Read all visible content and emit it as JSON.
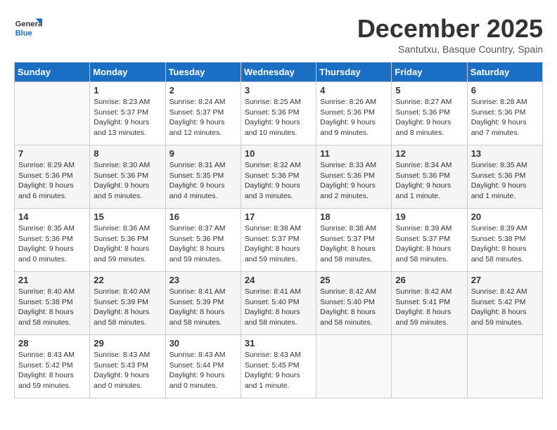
{
  "header": {
    "logo_line1": "General",
    "logo_line2": "Blue",
    "month": "December 2025",
    "location": "Santutxu, Basque Country, Spain"
  },
  "days_of_week": [
    "Sunday",
    "Monday",
    "Tuesday",
    "Wednesday",
    "Thursday",
    "Friday",
    "Saturday"
  ],
  "weeks": [
    [
      {
        "day": "",
        "sunrise": "",
        "sunset": "",
        "daylight": ""
      },
      {
        "day": "1",
        "sunrise": "Sunrise: 8:23 AM",
        "sunset": "Sunset: 5:37 PM",
        "daylight": "Daylight: 9 hours and 13 minutes."
      },
      {
        "day": "2",
        "sunrise": "Sunrise: 8:24 AM",
        "sunset": "Sunset: 5:37 PM",
        "daylight": "Daylight: 9 hours and 12 minutes."
      },
      {
        "day": "3",
        "sunrise": "Sunrise: 8:25 AM",
        "sunset": "Sunset: 5:36 PM",
        "daylight": "Daylight: 9 hours and 10 minutes."
      },
      {
        "day": "4",
        "sunrise": "Sunrise: 8:26 AM",
        "sunset": "Sunset: 5:36 PM",
        "daylight": "Daylight: 9 hours and 9 minutes."
      },
      {
        "day": "5",
        "sunrise": "Sunrise: 8:27 AM",
        "sunset": "Sunset: 5:36 PM",
        "daylight": "Daylight: 9 hours and 8 minutes."
      },
      {
        "day": "6",
        "sunrise": "Sunrise: 8:28 AM",
        "sunset": "Sunset: 5:36 PM",
        "daylight": "Daylight: 9 hours and 7 minutes."
      }
    ],
    [
      {
        "day": "7",
        "sunrise": "Sunrise: 8:29 AM",
        "sunset": "Sunset: 5:36 PM",
        "daylight": "Daylight: 9 hours and 6 minutes."
      },
      {
        "day": "8",
        "sunrise": "Sunrise: 8:30 AM",
        "sunset": "Sunset: 5:36 PM",
        "daylight": "Daylight: 9 hours and 5 minutes."
      },
      {
        "day": "9",
        "sunrise": "Sunrise: 8:31 AM",
        "sunset": "Sunset: 5:35 PM",
        "daylight": "Daylight: 9 hours and 4 minutes."
      },
      {
        "day": "10",
        "sunrise": "Sunrise: 8:32 AM",
        "sunset": "Sunset: 5:36 PM",
        "daylight": "Daylight: 9 hours and 3 minutes."
      },
      {
        "day": "11",
        "sunrise": "Sunrise: 8:33 AM",
        "sunset": "Sunset: 5:36 PM",
        "daylight": "Daylight: 9 hours and 2 minutes."
      },
      {
        "day": "12",
        "sunrise": "Sunrise: 8:34 AM",
        "sunset": "Sunset: 5:36 PM",
        "daylight": "Daylight: 9 hours and 1 minute."
      },
      {
        "day": "13",
        "sunrise": "Sunrise: 8:35 AM",
        "sunset": "Sunset: 5:36 PM",
        "daylight": "Daylight: 9 hours and 1 minute."
      }
    ],
    [
      {
        "day": "14",
        "sunrise": "Sunrise: 8:35 AM",
        "sunset": "Sunset: 5:36 PM",
        "daylight": "Daylight: 9 hours and 0 minutes."
      },
      {
        "day": "15",
        "sunrise": "Sunrise: 8:36 AM",
        "sunset": "Sunset: 5:36 PM",
        "daylight": "Daylight: 8 hours and 59 minutes."
      },
      {
        "day": "16",
        "sunrise": "Sunrise: 8:37 AM",
        "sunset": "Sunset: 5:36 PM",
        "daylight": "Daylight: 8 hours and 59 minutes."
      },
      {
        "day": "17",
        "sunrise": "Sunrise: 8:38 AM",
        "sunset": "Sunset: 5:37 PM",
        "daylight": "Daylight: 8 hours and 59 minutes."
      },
      {
        "day": "18",
        "sunrise": "Sunrise: 8:38 AM",
        "sunset": "Sunset: 5:37 PM",
        "daylight": "Daylight: 8 hours and 58 minutes."
      },
      {
        "day": "19",
        "sunrise": "Sunrise: 8:39 AM",
        "sunset": "Sunset: 5:37 PM",
        "daylight": "Daylight: 8 hours and 58 minutes."
      },
      {
        "day": "20",
        "sunrise": "Sunrise: 8:39 AM",
        "sunset": "Sunset: 5:38 PM",
        "daylight": "Daylight: 8 hours and 58 minutes."
      }
    ],
    [
      {
        "day": "21",
        "sunrise": "Sunrise: 8:40 AM",
        "sunset": "Sunset: 5:38 PM",
        "daylight": "Daylight: 8 hours and 58 minutes."
      },
      {
        "day": "22",
        "sunrise": "Sunrise: 8:40 AM",
        "sunset": "Sunset: 5:39 PM",
        "daylight": "Daylight: 8 hours and 58 minutes."
      },
      {
        "day": "23",
        "sunrise": "Sunrise: 8:41 AM",
        "sunset": "Sunset: 5:39 PM",
        "daylight": "Daylight: 8 hours and 58 minutes."
      },
      {
        "day": "24",
        "sunrise": "Sunrise: 8:41 AM",
        "sunset": "Sunset: 5:40 PM",
        "daylight": "Daylight: 8 hours and 58 minutes."
      },
      {
        "day": "25",
        "sunrise": "Sunrise: 8:42 AM",
        "sunset": "Sunset: 5:40 PM",
        "daylight": "Daylight: 8 hours and 58 minutes."
      },
      {
        "day": "26",
        "sunrise": "Sunrise: 8:42 AM",
        "sunset": "Sunset: 5:41 PM",
        "daylight": "Daylight: 8 hours and 59 minutes."
      },
      {
        "day": "27",
        "sunrise": "Sunrise: 8:42 AM",
        "sunset": "Sunset: 5:42 PM",
        "daylight": "Daylight: 8 hours and 59 minutes."
      }
    ],
    [
      {
        "day": "28",
        "sunrise": "Sunrise: 8:43 AM",
        "sunset": "Sunset: 5:42 PM",
        "daylight": "Daylight: 8 hours and 59 minutes."
      },
      {
        "day": "29",
        "sunrise": "Sunrise: 8:43 AM",
        "sunset": "Sunset: 5:43 PM",
        "daylight": "Daylight: 9 hours and 0 minutes."
      },
      {
        "day": "30",
        "sunrise": "Sunrise: 8:43 AM",
        "sunset": "Sunset: 5:44 PM",
        "daylight": "Daylight: 9 hours and 0 minutes."
      },
      {
        "day": "31",
        "sunrise": "Sunrise: 8:43 AM",
        "sunset": "Sunset: 5:45 PM",
        "daylight": "Daylight: 9 hours and 1 minute."
      },
      {
        "day": "",
        "sunrise": "",
        "sunset": "",
        "daylight": ""
      },
      {
        "day": "",
        "sunrise": "",
        "sunset": "",
        "daylight": ""
      },
      {
        "day": "",
        "sunrise": "",
        "sunset": "",
        "daylight": ""
      }
    ]
  ]
}
